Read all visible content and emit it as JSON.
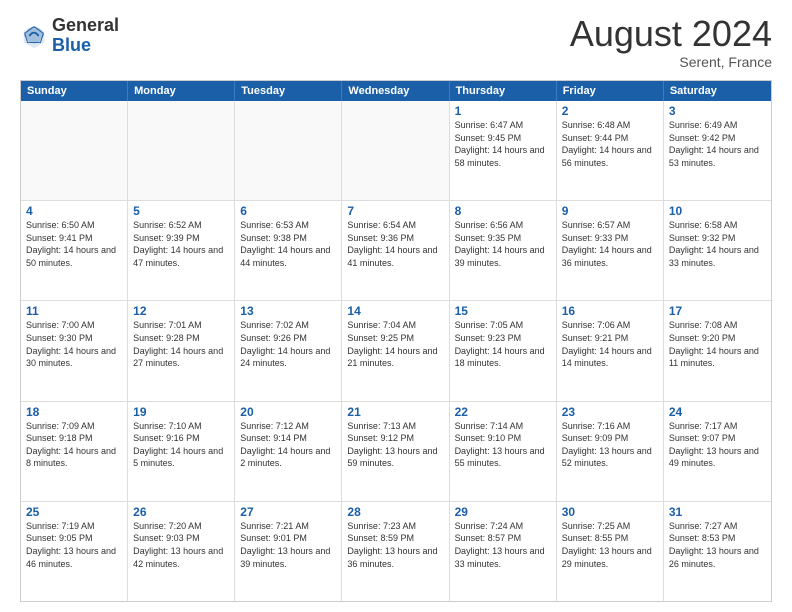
{
  "header": {
    "logo_general": "General",
    "logo_blue": "Blue",
    "month_title": "August 2024",
    "location": "Serent, France"
  },
  "days_of_week": [
    "Sunday",
    "Monday",
    "Tuesday",
    "Wednesday",
    "Thursday",
    "Friday",
    "Saturday"
  ],
  "weeks": [
    [
      {
        "day": "",
        "empty": true
      },
      {
        "day": "",
        "empty": true
      },
      {
        "day": "",
        "empty": true
      },
      {
        "day": "",
        "empty": true
      },
      {
        "day": "1",
        "sunrise": "6:47 AM",
        "sunset": "9:45 PM",
        "daylight": "14 hours and 58 minutes."
      },
      {
        "day": "2",
        "sunrise": "6:48 AM",
        "sunset": "9:44 PM",
        "daylight": "14 hours and 56 minutes."
      },
      {
        "day": "3",
        "sunrise": "6:49 AM",
        "sunset": "9:42 PM",
        "daylight": "14 hours and 53 minutes."
      }
    ],
    [
      {
        "day": "4",
        "sunrise": "6:50 AM",
        "sunset": "9:41 PM",
        "daylight": "14 hours and 50 minutes."
      },
      {
        "day": "5",
        "sunrise": "6:52 AM",
        "sunset": "9:39 PM",
        "daylight": "14 hours and 47 minutes."
      },
      {
        "day": "6",
        "sunrise": "6:53 AM",
        "sunset": "9:38 PM",
        "daylight": "14 hours and 44 minutes."
      },
      {
        "day": "7",
        "sunrise": "6:54 AM",
        "sunset": "9:36 PM",
        "daylight": "14 hours and 41 minutes."
      },
      {
        "day": "8",
        "sunrise": "6:56 AM",
        "sunset": "9:35 PM",
        "daylight": "14 hours and 39 minutes."
      },
      {
        "day": "9",
        "sunrise": "6:57 AM",
        "sunset": "9:33 PM",
        "daylight": "14 hours and 36 minutes."
      },
      {
        "day": "10",
        "sunrise": "6:58 AM",
        "sunset": "9:32 PM",
        "daylight": "14 hours and 33 minutes."
      }
    ],
    [
      {
        "day": "11",
        "sunrise": "7:00 AM",
        "sunset": "9:30 PM",
        "daylight": "14 hours and 30 minutes."
      },
      {
        "day": "12",
        "sunrise": "7:01 AM",
        "sunset": "9:28 PM",
        "daylight": "14 hours and 27 minutes."
      },
      {
        "day": "13",
        "sunrise": "7:02 AM",
        "sunset": "9:26 PM",
        "daylight": "14 hours and 24 minutes."
      },
      {
        "day": "14",
        "sunrise": "7:04 AM",
        "sunset": "9:25 PM",
        "daylight": "14 hours and 21 minutes."
      },
      {
        "day": "15",
        "sunrise": "7:05 AM",
        "sunset": "9:23 PM",
        "daylight": "14 hours and 18 minutes."
      },
      {
        "day": "16",
        "sunrise": "7:06 AM",
        "sunset": "9:21 PM",
        "daylight": "14 hours and 14 minutes."
      },
      {
        "day": "17",
        "sunrise": "7:08 AM",
        "sunset": "9:20 PM",
        "daylight": "14 hours and 11 minutes."
      }
    ],
    [
      {
        "day": "18",
        "sunrise": "7:09 AM",
        "sunset": "9:18 PM",
        "daylight": "14 hours and 8 minutes."
      },
      {
        "day": "19",
        "sunrise": "7:10 AM",
        "sunset": "9:16 PM",
        "daylight": "14 hours and 5 minutes."
      },
      {
        "day": "20",
        "sunrise": "7:12 AM",
        "sunset": "9:14 PM",
        "daylight": "14 hours and 2 minutes."
      },
      {
        "day": "21",
        "sunrise": "7:13 AM",
        "sunset": "9:12 PM",
        "daylight": "13 hours and 59 minutes."
      },
      {
        "day": "22",
        "sunrise": "7:14 AM",
        "sunset": "9:10 PM",
        "daylight": "13 hours and 55 minutes."
      },
      {
        "day": "23",
        "sunrise": "7:16 AM",
        "sunset": "9:09 PM",
        "daylight": "13 hours and 52 minutes."
      },
      {
        "day": "24",
        "sunrise": "7:17 AM",
        "sunset": "9:07 PM",
        "daylight": "13 hours and 49 minutes."
      }
    ],
    [
      {
        "day": "25",
        "sunrise": "7:19 AM",
        "sunset": "9:05 PM",
        "daylight": "13 hours and 46 minutes."
      },
      {
        "day": "26",
        "sunrise": "7:20 AM",
        "sunset": "9:03 PM",
        "daylight": "13 hours and 42 minutes."
      },
      {
        "day": "27",
        "sunrise": "7:21 AM",
        "sunset": "9:01 PM",
        "daylight": "13 hours and 39 minutes."
      },
      {
        "day": "28",
        "sunrise": "7:23 AM",
        "sunset": "8:59 PM",
        "daylight": "13 hours and 36 minutes."
      },
      {
        "day": "29",
        "sunrise": "7:24 AM",
        "sunset": "8:57 PM",
        "daylight": "13 hours and 33 minutes."
      },
      {
        "day": "30",
        "sunrise": "7:25 AM",
        "sunset": "8:55 PM",
        "daylight": "13 hours and 29 minutes."
      },
      {
        "day": "31",
        "sunrise": "7:27 AM",
        "sunset": "8:53 PM",
        "daylight": "13 hours and 26 minutes."
      }
    ]
  ]
}
